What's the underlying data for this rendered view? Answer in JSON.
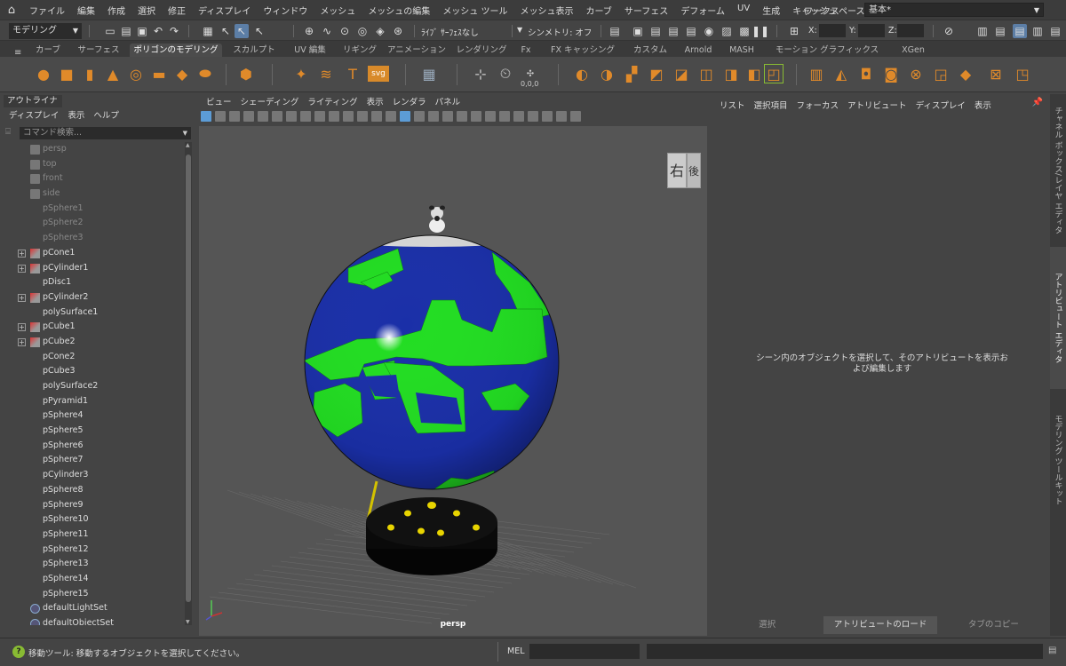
{
  "menubar": {
    "items": [
      "ファイル",
      "編集",
      "作成",
      "選択",
      "修正",
      "ディスプレイ",
      "ウィンドウ",
      "メッシュ",
      "メッシュの編集",
      "メッシュ ツール",
      "メッシュ表示",
      "カーブ",
      "サーフェス",
      "デフォーム",
      "UV",
      "生成",
      "キャッシュ"
    ],
    "workspace_label": "ワークスペース:",
    "workspace_value": "基本*"
  },
  "statusline": {
    "mode": "モデリング",
    "live_label": "ﾗｲﾌﾞ ｻｰﾌｪｽなし",
    "symmetry_label": "シンメトリ: オフ",
    "x_label": "X:",
    "y_label": "Y:",
    "z_label": "Z:"
  },
  "shelf": {
    "tabs": [
      "カーブ",
      "サーフェス",
      "ポリゴンのモデリング",
      "スカルプト",
      "UV 編集",
      "リギング",
      "アニメーション",
      "レンダリング",
      "Fx",
      "FX キャッシング",
      "カスタム",
      "Arnold",
      "MASH",
      "モーション グラフィックス",
      "XGen"
    ],
    "selected_tab": "ポリゴンのモデリング",
    "svg_label": "svg",
    "zero_label": "0,0,0"
  },
  "outliner": {
    "tab": "アウトライナ",
    "menu": [
      "ディスプレイ",
      "表示",
      "ヘルプ"
    ],
    "search_placeholder": "コマンド検索...",
    "items": [
      {
        "label": "persp",
        "icon": "camera",
        "dim": true,
        "expand": false
      },
      {
        "label": "top",
        "icon": "camera",
        "dim": true,
        "expand": false
      },
      {
        "label": "front",
        "icon": "camera",
        "dim": true,
        "expand": false
      },
      {
        "label": "side",
        "icon": "camera",
        "dim": true,
        "expand": false
      },
      {
        "label": "pSphere1",
        "icon": "none",
        "dim": true,
        "expand": false
      },
      {
        "label": "pSphere2",
        "icon": "none",
        "dim": true,
        "expand": false
      },
      {
        "label": "pSphere3",
        "icon": "none",
        "dim": true,
        "expand": false
      },
      {
        "label": "pCone1",
        "icon": "mesh",
        "dim": false,
        "expand": true
      },
      {
        "label": "pCylinder1",
        "icon": "mesh",
        "dim": false,
        "expand": true
      },
      {
        "label": "pDisc1",
        "icon": "none",
        "dim": false,
        "expand": false
      },
      {
        "label": "pCylinder2",
        "icon": "mesh",
        "dim": false,
        "expand": true
      },
      {
        "label": "polySurface1",
        "icon": "none",
        "dim": false,
        "expand": false
      },
      {
        "label": "pCube1",
        "icon": "mesh",
        "dim": false,
        "expand": true
      },
      {
        "label": "pCube2",
        "icon": "mesh",
        "dim": false,
        "expand": true
      },
      {
        "label": "pCone2",
        "icon": "none",
        "dim": false,
        "expand": false
      },
      {
        "label": "pCube3",
        "icon": "none",
        "dim": false,
        "expand": false
      },
      {
        "label": "polySurface2",
        "icon": "none",
        "dim": false,
        "expand": false
      },
      {
        "label": "pPyramid1",
        "icon": "none",
        "dim": false,
        "expand": false
      },
      {
        "label": "pSphere4",
        "icon": "none",
        "dim": false,
        "expand": false
      },
      {
        "label": "pSphere5",
        "icon": "none",
        "dim": false,
        "expand": false
      },
      {
        "label": "pSphere6",
        "icon": "none",
        "dim": false,
        "expand": false
      },
      {
        "label": "pSphere7",
        "icon": "none",
        "dim": false,
        "expand": false
      },
      {
        "label": "pCylinder3",
        "icon": "none",
        "dim": false,
        "expand": false
      },
      {
        "label": "pSphere8",
        "icon": "none",
        "dim": false,
        "expand": false
      },
      {
        "label": "pSphere9",
        "icon": "none",
        "dim": false,
        "expand": false
      },
      {
        "label": "pSphere10",
        "icon": "none",
        "dim": false,
        "expand": false
      },
      {
        "label": "pSphere11",
        "icon": "none",
        "dim": false,
        "expand": false
      },
      {
        "label": "pSphere12",
        "icon": "none",
        "dim": false,
        "expand": false
      },
      {
        "label": "pSphere13",
        "icon": "none",
        "dim": false,
        "expand": false
      },
      {
        "label": "pSphere14",
        "icon": "none",
        "dim": false,
        "expand": false
      },
      {
        "label": "pSphere15",
        "icon": "none",
        "dim": false,
        "expand": false
      },
      {
        "label": "defaultLightSet",
        "icon": "set",
        "dim": false,
        "expand": false
      },
      {
        "label": "defaultObjectSet",
        "icon": "set",
        "dim": false,
        "expand": false
      }
    ]
  },
  "viewport": {
    "menu": [
      "ビュー",
      "シェーディング",
      "ライティング",
      "表示",
      "レンダラ",
      "パネル"
    ],
    "camera": "persp",
    "viewcube_right": "右",
    "viewcube_back": "後"
  },
  "attribute_editor": {
    "menu": [
      "リスト",
      "選択項目",
      "フォーカス",
      "アトリビュート",
      "ディスプレイ",
      "表示"
    ],
    "message": "シーン内のオブジェクトを選択して、そのアトリビュートを表示および編集します",
    "buttons": [
      "選択",
      "アトリビュートのロード",
      "タブのコピー"
    ]
  },
  "right_tabs": [
    "チャネル ボックス/レイヤ エディタ",
    "アトリビュート エディタ",
    "モデリング ツールキット"
  ],
  "helpline": {
    "text": "移動ツール: 移動するオブジェクトを選択してください。",
    "mel_label": "MEL"
  },
  "colors": {
    "globe_ocean": "#1a2fa8",
    "globe_land": "#22dd22",
    "base": "#0a0a0a",
    "base_dots": "#e8d400",
    "accent": "#5c9cd6"
  }
}
